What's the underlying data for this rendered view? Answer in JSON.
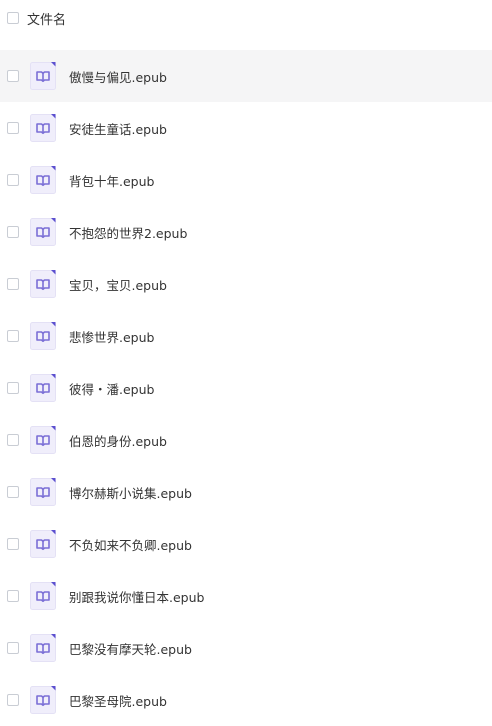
{
  "header": {
    "title": "文件名"
  },
  "files": [
    {
      "name": "傲慢与偏见.epub",
      "highlighted": true
    },
    {
      "name": "安徒生童话.epub"
    },
    {
      "name": "背包十年.epub"
    },
    {
      "name": "不抱怨的世界2.epub"
    },
    {
      "name": "宝贝，宝贝.epub"
    },
    {
      "name": "悲惨世界.epub"
    },
    {
      "name": "彼得・潘.epub"
    },
    {
      "name": "伯恩的身份.epub"
    },
    {
      "name": "博尔赫斯小说集.epub"
    },
    {
      "name": "不负如来不负卿.epub"
    },
    {
      "name": "别跟我说你懂日本.epub"
    },
    {
      "name": "巴黎没有摩天轮.epub"
    },
    {
      "name": "巴黎圣母院.epub"
    }
  ],
  "icon": {
    "name": "epub-book-icon",
    "color": "#7b6fd6",
    "bg": "#f0eefb"
  }
}
